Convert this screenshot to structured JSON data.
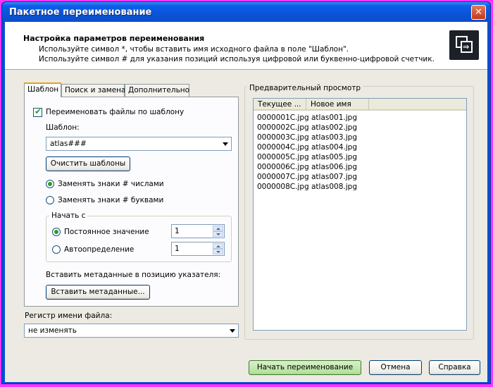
{
  "window": {
    "title": "Пакетное переименование",
    "close_label": "✕"
  },
  "header": {
    "title": "Настройка параметров переименования",
    "line1": "Используйте символ *, чтобы вставить имя исходного файла в поле \"Шаблон\".",
    "line2": "Используйте символ # для указания позиций используя цифровой или буквенно-цифровой счетчик.",
    "icon": "batch-rename-icon"
  },
  "tabs": [
    "Шаблон",
    "Поиск и замена",
    "Дополнительно"
  ],
  "template_tab": {
    "rename_checkbox_label": "Переименовать файлы по шаблону",
    "rename_checked": true,
    "template_label": "Шаблон:",
    "template_value": "atlas###",
    "clear_button": "Очистить шаблоны",
    "radio_numbers": "Заменять знаки # числами",
    "radio_letters": "Заменять знаки # буквами",
    "radio_selected": "numbers",
    "start_group_label": "Начать с",
    "start_constant_label": "Постоянное значение",
    "start_constant_value": "1",
    "start_auto_label": "Автоопределение",
    "start_auto_value": "1",
    "start_selected": "constant",
    "metadata_label": "Вставить метаданные в позицию указателя:",
    "metadata_button": "Вставить метаданные..."
  },
  "case": {
    "label": "Регистр имени файла:",
    "value": "не изменять"
  },
  "preview": {
    "label": "Предварительный просмотр",
    "columns": [
      "Текущее ...",
      "Новое имя"
    ],
    "rows": [
      [
        "0000001C.jpg",
        "atlas001.jpg"
      ],
      [
        "0000002C.jpg",
        "atlas002.jpg"
      ],
      [
        "0000003C.jpg",
        "atlas003.jpg"
      ],
      [
        "0000004C.jpg",
        "atlas004.jpg"
      ],
      [
        "0000005C.jpg",
        "atlas005.jpg"
      ],
      [
        "0000006C.jpg",
        "atlas006.jpg"
      ],
      [
        "0000007C.jpg",
        "atlas007.jpg"
      ],
      [
        "0000008C.jpg",
        "atlas008.jpg"
      ]
    ]
  },
  "footer": {
    "start_button": "Начать переименование",
    "cancel_button": "Отмена",
    "help_button": "Справка"
  }
}
